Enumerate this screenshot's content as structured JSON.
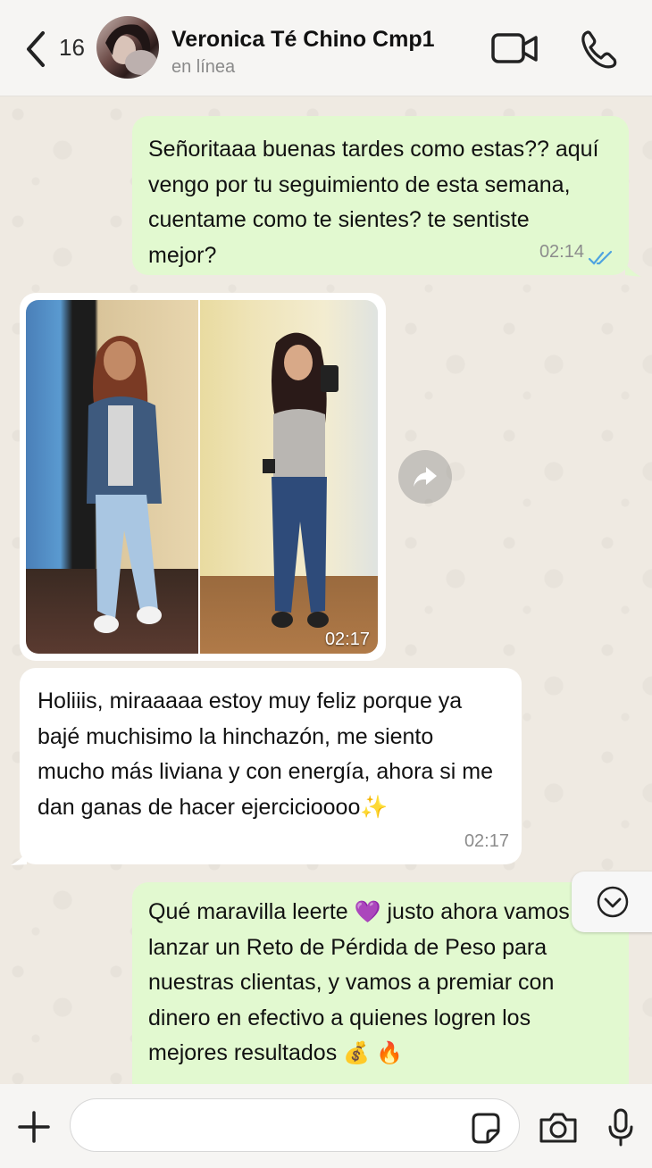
{
  "header": {
    "back_count": "16",
    "contact_name": "Veronica Té Chino Cmp1",
    "status": "en línea"
  },
  "messages": [
    {
      "direction": "outgoing",
      "text": "Señoritaaa buenas tardes como estas?? aquí vengo por tu seguimiento de esta semana, cuentame como te sientes? te sentiste mejor?",
      "time": "02:14",
      "read": true
    },
    {
      "direction": "incoming",
      "type": "image",
      "time": "02:17"
    },
    {
      "direction": "incoming",
      "text": "Holiiis, miraaaaa estoy muy feliz porque ya bajé muchisimo la hinchazón, me siento mucho más liviana y con energía, ahora si me dan ganas de hacer ejercicioooo✨",
      "time": "02:17"
    },
    {
      "direction": "outgoing",
      "text_part1": "Qué maravilla leerte ",
      "emoji_heart": "💜",
      "text_part2": " justo ahora vamos a lanzar un Reto de Pérdida de Peso para nuestras clientas, y vamos a premiar con dinero en efectivo a quienes logren los mejores resultados ",
      "emoji_money": "💰",
      "emoji_fire": "🔥"
    }
  ],
  "composer": {
    "placeholder": ""
  },
  "colors": {
    "outgoing_bubble": "#e2f9d0",
    "incoming_bubble": "#ffffff",
    "read_ticks": "#4fa3e0"
  }
}
